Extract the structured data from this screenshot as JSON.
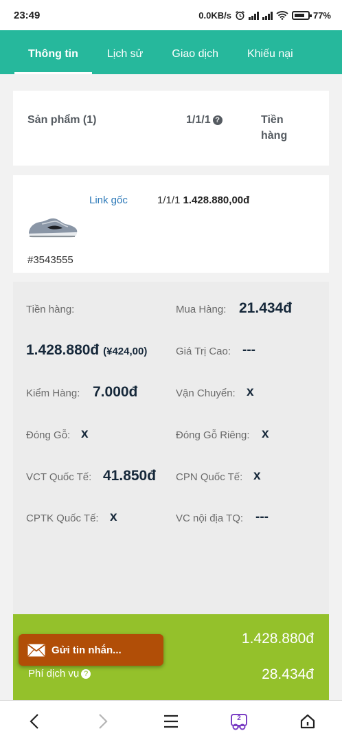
{
  "status": {
    "time": "23:49",
    "net_speed": "0.0KB/s",
    "battery": "77%",
    "icons": [
      "alarm-icon",
      "signal-icon",
      "signal-icon",
      "wifi-icon",
      "battery-icon"
    ]
  },
  "tabs": [
    {
      "label": "Thông tin",
      "active": true
    },
    {
      "label": "Lịch sử",
      "active": false
    },
    {
      "label": "Giao dịch",
      "active": false
    },
    {
      "label": "Khiếu nại",
      "active": false
    }
  ],
  "header": {
    "product_label": "Sản phẩm (1)",
    "qty_label": "1/1/1",
    "amount_label_1": "Tiền",
    "amount_label_2": "hàng"
  },
  "product": {
    "link_label": "Link gốc",
    "qty": "1/1/1",
    "price": "1.428.880,00đ",
    "code": "#3543555"
  },
  "summary": {
    "tien_hang_label": "Tiền hàng:",
    "tien_hang_value": "1.428.880đ",
    "tien_hang_cny": "(¥424,00)",
    "mua_hang_label": "Mua Hàng:",
    "mua_hang_value": "21.434đ",
    "gia_tri_cao_label": "Giá Trị Cao:",
    "gia_tri_cao_value": "---",
    "kiem_hang_label": "Kiểm Hàng:",
    "kiem_hang_value": "7.000đ",
    "van_chuyen_label": "Vận Chuyển:",
    "van_chuyen_value": "x",
    "dong_go_label": "Đóng Gỗ:",
    "dong_go_value": "x",
    "dong_go_rieng_label": "Đóng Gỗ Riêng:",
    "dong_go_rieng_value": "x",
    "vct_label": "VCT Quốc Tế:",
    "vct_value": "41.850đ",
    "cpn_label": "CPN Quốc Tế:",
    "cpn_value": "x",
    "cptk_label": "CPTK Quốc Tế:",
    "cptk_value": "x",
    "vc_noi_dia_label": "VC nội địa TQ:",
    "vc_noi_dia_value": "---"
  },
  "totals": {
    "row1_value": "1.428.880đ",
    "phi_dich_vu_label": "Phí dịch vụ",
    "phi_dich_vu_value": "28.434đ"
  },
  "message_button": {
    "label": "Gửi tin nhắn..."
  },
  "nav": {
    "tabs_count": "2"
  },
  "colors": {
    "tab_bar": "#26b89c",
    "link": "#2b78b8",
    "totals_bg": "#94c12b",
    "message_button": "#b14e07",
    "nav_accent": "#7b3fc4"
  }
}
